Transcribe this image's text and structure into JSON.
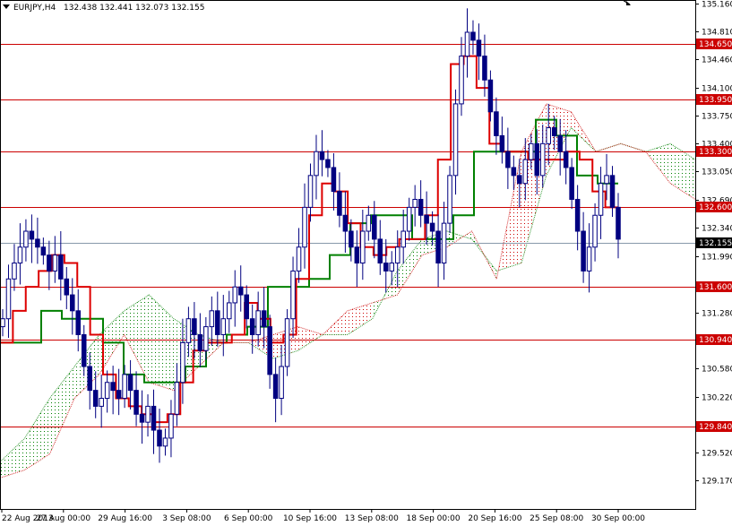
{
  "header": {
    "symbol": "EURJPY,H4",
    "ohlc": "132.438 132.441 132.073 132.155"
  },
  "colors": {
    "background": "#ffffff",
    "frame": "#000000",
    "hline": "#cc0000",
    "hline_label_bg": "#cc0000",
    "price_line": "#8899aa",
    "price_label_bg": "#000000",
    "candle": "#000080",
    "tenkan": "#dd0000",
    "kijun": "#008000",
    "cloud_bull": "#008000",
    "cloud_bear": "#cc0000"
  },
  "chart_data": {
    "type": "candlestick",
    "symbol": "EURJPY",
    "timeframe": "H4",
    "ylim": [
      129.17,
      135.16
    ],
    "y_ticks": [
      "135.160",
      "134.810",
      "134.460",
      "134.100",
      "133.750",
      "133.400",
      "133.050",
      "132.690",
      "132.340",
      "131.990",
      "131.630",
      "131.280",
      "130.930",
      "130.580",
      "130.220",
      "129.870",
      "129.520",
      "129.170"
    ],
    "x_ticks": [
      "22 Aug 2013",
      "27 Aug 00:00",
      "29 Aug 16:00",
      "3 Sep 08:00",
      "6 Sep 00:00",
      "10 Sep 16:00",
      "13 Sep 08:00",
      "18 Sep 00:00",
      "20 Sep 16:00",
      "25 Sep 08:00",
      "30 Sep 00:00"
    ],
    "horizontal_levels": [
      {
        "label": "134.650",
        "value": 134.65
      },
      {
        "label": "133.950",
        "value": 133.95
      },
      {
        "label": "133.300",
        "value": 133.3
      },
      {
        "label": "132.600",
        "value": 132.6
      },
      {
        "label": "131.600",
        "value": 131.6
      },
      {
        "label": "130.940",
        "value": 130.94
      },
      {
        "label": "129.840",
        "value": 129.84
      }
    ],
    "current_price": {
      "label": "132.155",
      "value": 132.155
    },
    "candles": [
      131.2,
      131.7,
      131.9,
      132.1,
      132.3,
      132.2,
      132.1,
      132.0,
      131.8,
      132.0,
      131.7,
      131.5,
      131.3,
      131.0,
      130.6,
      130.3,
      130.1,
      130.2,
      130.4,
      130.3,
      130.2,
      130.5,
      130.3,
      130.0,
      129.9,
      130.1,
      129.8,
      129.6,
      129.7,
      130.0,
      130.4,
      130.9,
      131.2,
      131.0,
      130.8,
      131.1,
      131.3,
      131.0,
      131.2,
      131.4,
      131.6,
      131.5,
      131.2,
      131.0,
      131.3,
      131.1,
      130.5,
      130.2,
      130.6,
      131.2,
      131.8,
      132.1,
      132.6,
      133.0,
      133.3,
      133.2,
      133.1,
      132.8,
      132.5,
      132.3,
      132.1,
      131.9,
      132.3,
      132.5,
      132.2,
      131.9,
      131.8,
      131.9,
      132.1,
      132.3,
      132.6,
      132.7,
      132.5,
      132.4,
      132.3,
      131.9,
      132.4,
      133.0,
      133.9,
      134.5,
      134.8,
      134.7,
      134.5,
      134.2,
      133.8,
      133.5,
      133.3,
      133.1,
      133.0,
      132.9,
      133.2,
      133.4,
      133.0,
      133.4,
      133.6,
      133.5,
      133.3,
      133.1,
      132.7,
      132.3,
      131.8,
      132.1,
      132.5,
      132.9,
      133.0,
      132.6,
      132.2
    ],
    "tenkan_sen": [
      130.9,
      131.3,
      131.6,
      131.8,
      132.0,
      131.9,
      131.6,
      131.0,
      130.5,
      130.2,
      130.1,
      130.0,
      129.9,
      130.0,
      130.4,
      130.8,
      130.9,
      130.9,
      131.0,
      131.4,
      131.2,
      130.9,
      131.0,
      131.7,
      132.5,
      132.9,
      132.8,
      132.4,
      132.1,
      132.0,
      132.1,
      132.2,
      132.2,
      132.5,
      133.2,
      134.4,
      134.5,
      134.1,
      133.4,
      133.3,
      133.3,
      133.2,
      133.2,
      133.2,
      133.3,
      133.2,
      132.8,
      132.6,
      132.6
    ],
    "kijun_sen": [
      130.9,
      130.9,
      131.3,
      131.2,
      131.2,
      130.9,
      130.5,
      130.4,
      130.4,
      130.6,
      130.9,
      131.0,
      131.1,
      131.6,
      131.6,
      131.7,
      132.0,
      132.4,
      132.5,
      132.5,
      132.2,
      132.2,
      132.5,
      133.3,
      133.3,
      133.3,
      133.7,
      133.5,
      133.0,
      132.9,
      132.9
    ],
    "senkou_a": [
      129.4,
      129.7,
      130.2,
      130.6,
      131.0,
      131.3,
      131.5,
      131.2,
      131.0,
      130.9,
      130.9,
      130.7,
      130.8,
      131.0,
      131.0,
      131.2,
      131.8,
      132.2,
      132.3,
      132.2,
      131.8,
      131.9,
      133.0,
      133.6,
      133.3,
      133.4,
      133.3,
      133.4,
      133.2
    ],
    "senkou_b": [
      129.2,
      129.3,
      129.5,
      130.2,
      130.5,
      131.0,
      130.4,
      130.3,
      130.6,
      130.9,
      130.9,
      131.0,
      131.1,
      131.0,
      131.3,
      131.4,
      131.5,
      132.0,
      132.1,
      132.3,
      131.7,
      133.3,
      133.9,
      133.8,
      133.3,
      133.4,
      133.3,
      132.9,
      132.7
    ]
  }
}
